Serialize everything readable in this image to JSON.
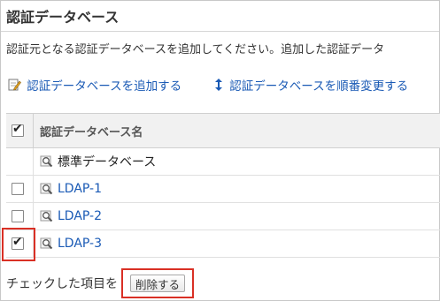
{
  "page": {
    "title": "認証データベース",
    "description": "認証元となる認証データベースを追加してください。追加した認証データ"
  },
  "actions": {
    "add_label": "認証データベースを追加する",
    "reorder_label": "認証データベースを順番変更する"
  },
  "table": {
    "header": "認証データベース名",
    "rows": [
      {
        "name": "標準データベース",
        "has_checkbox": false,
        "checked": false,
        "is_link": false
      },
      {
        "name": "LDAP-1",
        "has_checkbox": true,
        "checked": false,
        "is_link": true
      },
      {
        "name": "LDAP-2",
        "has_checkbox": true,
        "checked": false,
        "is_link": true
      },
      {
        "name": "LDAP-3",
        "has_checkbox": true,
        "checked": true,
        "is_link": true
      }
    ]
  },
  "footer": {
    "checked_items_label": "チェックした項目を",
    "delete_button": "削除する"
  },
  "colors": {
    "link": "#1a5ab5",
    "highlight": "#d93025"
  },
  "icons": {
    "add": "edit-pencil-icon",
    "reorder": "up-down-arrow-icon",
    "db": "magnifier-db-icon"
  }
}
